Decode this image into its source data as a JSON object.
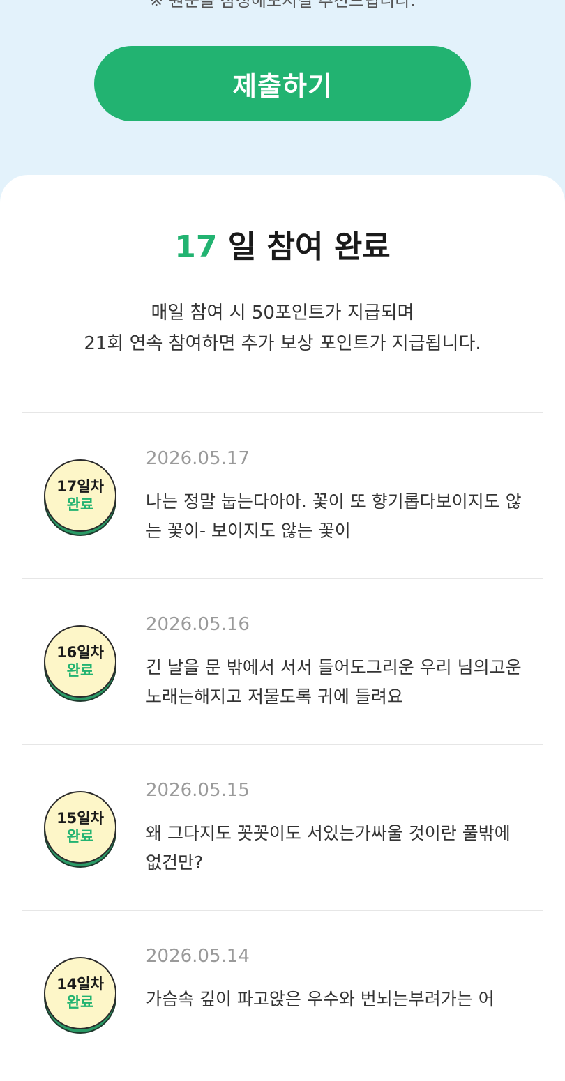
{
  "top_note": "※ 원문을 참정해보시길 추천드립니다.",
  "submit_label": "제출하기",
  "summary": {
    "count": "17",
    "label": " 일 참여 완료",
    "desc_line1": "매일 참여 시 50포인트가 지급되며",
    "desc_line2": "21회 연속 참여하면 추가 보상 포인트가 지급됩니다."
  },
  "entries": [
    {
      "badge_day": "17일차",
      "badge_status": "완료",
      "date": "2026.05.17",
      "text": "나는 정말 눕는다아아. 꽃이 또 향기롭다보이지도 않는 꽃이- 보이지도 않는 꽃이"
    },
    {
      "badge_day": "16일차",
      "badge_status": "완료",
      "date": "2026.05.16",
      "text": "긴 날을 문 밖에서 서서 들어도그리운 우리 님의고운 노래는해지고 저물도록 귀에 들려요"
    },
    {
      "badge_day": "15일차",
      "badge_status": "완료",
      "date": "2026.05.15",
      "text": "왜 그다지도 꼿꼿이도 서있는가싸울 것이란 풀밖에 없건만?"
    },
    {
      "badge_day": "14일차",
      "badge_status": "완료",
      "date": "2026.05.14",
      "text": "가슴속 깊이 파고앉은 우수와 번뇌는부려가는 어"
    }
  ],
  "colors": {
    "accent": "#22b371",
    "background": "#e3f2fb",
    "badge_face": "#fdf6c8"
  }
}
